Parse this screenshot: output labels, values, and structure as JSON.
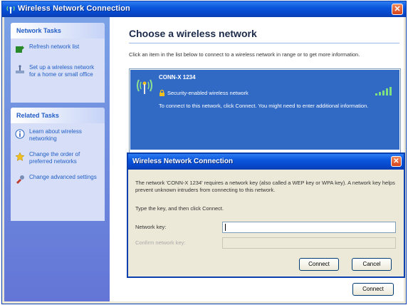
{
  "window": {
    "title": "Wireless Network Connection",
    "close_glyph": "✕"
  },
  "sidebar": {
    "network_tasks": {
      "header": "Network Tasks",
      "items": [
        {
          "label": "Refresh network list",
          "icon": "refresh-icon"
        },
        {
          "label": "Set up a wireless network for a home or small office",
          "icon": "setup-network-icon"
        }
      ]
    },
    "related_tasks": {
      "header": "Related Tasks",
      "items": [
        {
          "label": "Learn about wireless networking",
          "icon": "info-icon"
        },
        {
          "label": "Change the order of preferred networks",
          "icon": "star-icon"
        },
        {
          "label": "Change advanced settings",
          "icon": "settings-icon"
        }
      ]
    }
  },
  "main": {
    "title": "Choose a wireless network",
    "instructions": "Click an item in the list below to connect to a wireless network in range or to get more information.",
    "network": {
      "name": "CONN-X 1234",
      "security": "Security-enabled wireless network",
      "description": "To connect to this network, click Connect. You might need to enter additional information."
    },
    "connect_label": "Connect"
  },
  "dialog": {
    "title": "Wireless Network Connection",
    "close_glyph": "✕",
    "message": "The network 'CONN-X 1234' requires a network key (also called a WEP key or WPA key). A network key helps prevent unknown intruders from connecting to this network.",
    "type_prompt": "Type the key, and then click Connect.",
    "network_key_label": "Network key:",
    "network_key_value": "",
    "confirm_key_label": "Confirm network key:",
    "confirm_key_value": "",
    "connect_label": "Connect",
    "cancel_label": "Cancel"
  },
  "colors": {
    "title_bar": "#0a56dc",
    "selection": "#316ac5",
    "sidebar": "#6375d6",
    "link": "#215dc6"
  }
}
